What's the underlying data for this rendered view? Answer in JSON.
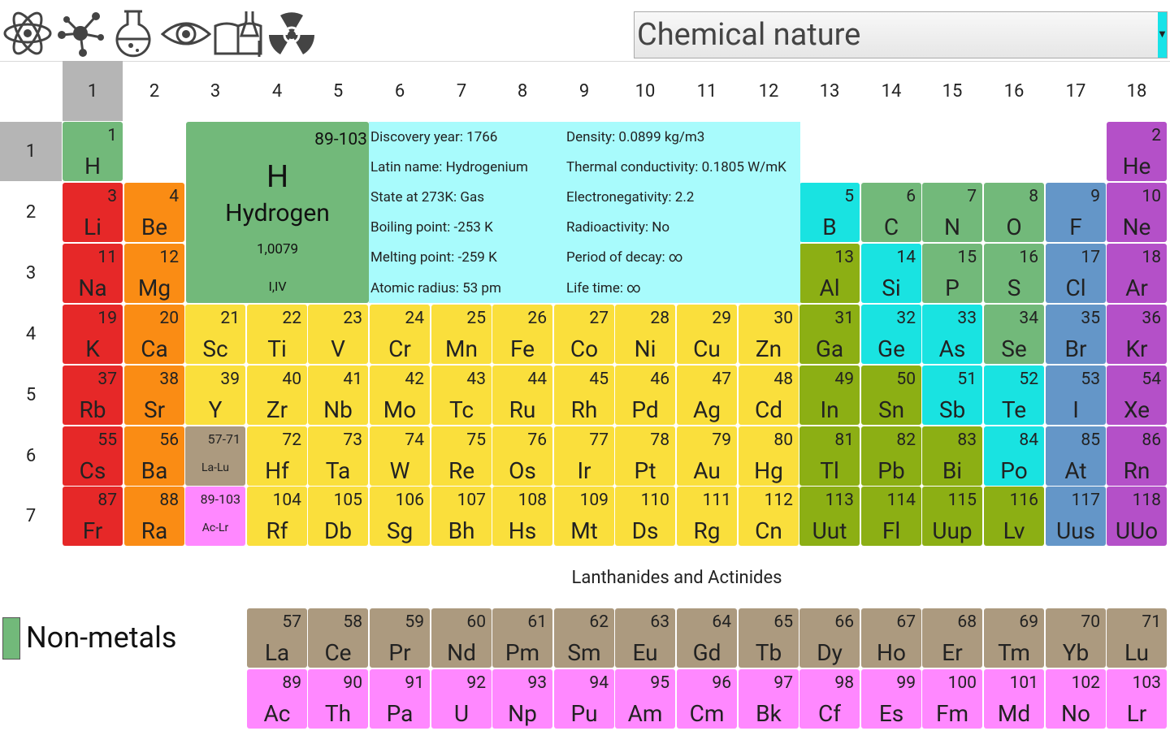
{
  "toolbar": {
    "icons": [
      "atom-icon",
      "molecule-icon",
      "flask-icon",
      "eye-icon",
      "book-lab-icon",
      "radiation-icon"
    ],
    "nature_select": {
      "value": "Chemical nature"
    }
  },
  "colors": {
    "alkali": "#e62828",
    "alkaline": "#fa8c14",
    "transition": "#fadf3c",
    "post_transition": "#8caf14",
    "metalloid": "#19e3e1",
    "nonmetal": "#72b97a",
    "halogen": "#6496c8",
    "noble": "#b450c8",
    "lanthanide": "#ac9a7f",
    "actinide": "#ff88ff",
    "info_bg": "#a8fbfc",
    "header_selected": "#b5b5b5"
  },
  "groups": [
    "1",
    "2",
    "3",
    "4",
    "5",
    "6",
    "7",
    "8",
    "9",
    "10",
    "11",
    "12",
    "13",
    "14",
    "15",
    "16",
    "17",
    "18"
  ],
  "periods": [
    "1",
    "2",
    "3",
    "4",
    "5",
    "6",
    "7"
  ],
  "selected_group": "1",
  "selected_period": "1",
  "selected": {
    "range_label": "89-103",
    "symbol": "H",
    "name": "Hydrogen",
    "mass": "1,0079",
    "oxidation": "I,IV"
  },
  "info": {
    "discovery": "Discovery year: 1766",
    "latin": "Latin name: Hydrogenium",
    "state": "State at 273K: Gas",
    "boiling": "Boiling point: -253 K",
    "melting": "Melting point: -259 K",
    "radius": "Atomic radius: 53 pm",
    "density": "Density: 0.0899 kg/m3",
    "conductivity": "Thermal conductivity: 0.1805 W/mK",
    "electroneg": "Electronegativity: 2.2",
    "radioactivity": "Radioactivity: No",
    "decay": "Period of decay: ∞",
    "lifetime": "Life time: ∞"
  },
  "elements": [
    {
      "n": "1",
      "s": "H",
      "g": 1,
      "p": 1,
      "c": "nonmetal"
    },
    {
      "n": "2",
      "s": "He",
      "g": 18,
      "p": 1,
      "c": "noble"
    },
    {
      "n": "3",
      "s": "Li",
      "g": 1,
      "p": 2,
      "c": "alkali"
    },
    {
      "n": "4",
      "s": "Be",
      "g": 2,
      "p": 2,
      "c": "alkaline"
    },
    {
      "n": "5",
      "s": "B",
      "g": 13,
      "p": 2,
      "c": "metalloid"
    },
    {
      "n": "6",
      "s": "C",
      "g": 14,
      "p": 2,
      "c": "nonmetal"
    },
    {
      "n": "7",
      "s": "N",
      "g": 15,
      "p": 2,
      "c": "nonmetal"
    },
    {
      "n": "8",
      "s": "O",
      "g": 16,
      "p": 2,
      "c": "nonmetal"
    },
    {
      "n": "9",
      "s": "F",
      "g": 17,
      "p": 2,
      "c": "halogen"
    },
    {
      "n": "10",
      "s": "Ne",
      "g": 18,
      "p": 2,
      "c": "noble"
    },
    {
      "n": "11",
      "s": "Na",
      "g": 1,
      "p": 3,
      "c": "alkali"
    },
    {
      "n": "12",
      "s": "Mg",
      "g": 2,
      "p": 3,
      "c": "alkaline"
    },
    {
      "n": "13",
      "s": "Al",
      "g": 13,
      "p": 3,
      "c": "post_transition"
    },
    {
      "n": "14",
      "s": "Si",
      "g": 14,
      "p": 3,
      "c": "metalloid"
    },
    {
      "n": "15",
      "s": "P",
      "g": 15,
      "p": 3,
      "c": "nonmetal"
    },
    {
      "n": "16",
      "s": "S",
      "g": 16,
      "p": 3,
      "c": "nonmetal"
    },
    {
      "n": "17",
      "s": "Cl",
      "g": 17,
      "p": 3,
      "c": "halogen"
    },
    {
      "n": "18",
      "s": "Ar",
      "g": 18,
      "p": 3,
      "c": "noble"
    },
    {
      "n": "19",
      "s": "K",
      "g": 1,
      "p": 4,
      "c": "alkali"
    },
    {
      "n": "20",
      "s": "Ca",
      "g": 2,
      "p": 4,
      "c": "alkaline"
    },
    {
      "n": "21",
      "s": "Sc",
      "g": 3,
      "p": 4,
      "c": "transition"
    },
    {
      "n": "22",
      "s": "Ti",
      "g": 4,
      "p": 4,
      "c": "transition"
    },
    {
      "n": "23",
      "s": "V",
      "g": 5,
      "p": 4,
      "c": "transition"
    },
    {
      "n": "24",
      "s": "Cr",
      "g": 6,
      "p": 4,
      "c": "transition"
    },
    {
      "n": "25",
      "s": "Mn",
      "g": 7,
      "p": 4,
      "c": "transition"
    },
    {
      "n": "26",
      "s": "Fe",
      "g": 8,
      "p": 4,
      "c": "transition"
    },
    {
      "n": "27",
      "s": "Co",
      "g": 9,
      "p": 4,
      "c": "transition"
    },
    {
      "n": "28",
      "s": "Ni",
      "g": 10,
      "p": 4,
      "c": "transition"
    },
    {
      "n": "29",
      "s": "Cu",
      "g": 11,
      "p": 4,
      "c": "transition"
    },
    {
      "n": "30",
      "s": "Zn",
      "g": 12,
      "p": 4,
      "c": "transition"
    },
    {
      "n": "31",
      "s": "Ga",
      "g": 13,
      "p": 4,
      "c": "post_transition"
    },
    {
      "n": "32",
      "s": "Ge",
      "g": 14,
      "p": 4,
      "c": "metalloid"
    },
    {
      "n": "33",
      "s": "As",
      "g": 15,
      "p": 4,
      "c": "metalloid"
    },
    {
      "n": "34",
      "s": "Se",
      "g": 16,
      "p": 4,
      "c": "nonmetal"
    },
    {
      "n": "35",
      "s": "Br",
      "g": 17,
      "p": 4,
      "c": "halogen"
    },
    {
      "n": "36",
      "s": "Kr",
      "g": 18,
      "p": 4,
      "c": "noble"
    },
    {
      "n": "37",
      "s": "Rb",
      "g": 1,
      "p": 5,
      "c": "alkali"
    },
    {
      "n": "38",
      "s": "Sr",
      "g": 2,
      "p": 5,
      "c": "alkaline"
    },
    {
      "n": "39",
      "s": "Y",
      "g": 3,
      "p": 5,
      "c": "transition"
    },
    {
      "n": "40",
      "s": "Zr",
      "g": 4,
      "p": 5,
      "c": "transition"
    },
    {
      "n": "41",
      "s": "Nb",
      "g": 5,
      "p": 5,
      "c": "transition"
    },
    {
      "n": "42",
      "s": "Mo",
      "g": 6,
      "p": 5,
      "c": "transition"
    },
    {
      "n": "43",
      "s": "Tc",
      "g": 7,
      "p": 5,
      "c": "transition"
    },
    {
      "n": "44",
      "s": "Ru",
      "g": 8,
      "p": 5,
      "c": "transition"
    },
    {
      "n": "45",
      "s": "Rh",
      "g": 9,
      "p": 5,
      "c": "transition"
    },
    {
      "n": "46",
      "s": "Pd",
      "g": 10,
      "p": 5,
      "c": "transition"
    },
    {
      "n": "47",
      "s": "Ag",
      "g": 11,
      "p": 5,
      "c": "transition"
    },
    {
      "n": "48",
      "s": "Cd",
      "g": 12,
      "p": 5,
      "c": "transition"
    },
    {
      "n": "49",
      "s": "In",
      "g": 13,
      "p": 5,
      "c": "post_transition"
    },
    {
      "n": "50",
      "s": "Sn",
      "g": 14,
      "p": 5,
      "c": "post_transition"
    },
    {
      "n": "51",
      "s": "Sb",
      "g": 15,
      "p": 5,
      "c": "metalloid"
    },
    {
      "n": "52",
      "s": "Te",
      "g": 16,
      "p": 5,
      "c": "metalloid"
    },
    {
      "n": "53",
      "s": "I",
      "g": 17,
      "p": 5,
      "c": "halogen"
    },
    {
      "n": "54",
      "s": "Xe",
      "g": 18,
      "p": 5,
      "c": "noble"
    },
    {
      "n": "55",
      "s": "Cs",
      "g": 1,
      "p": 6,
      "c": "alkali"
    },
    {
      "n": "56",
      "s": "Ba",
      "g": 2,
      "p": 6,
      "c": "alkaline"
    },
    {
      "n": "57-71",
      "s": "La-Lu",
      "g": 3,
      "p": 6,
      "c": "lanthanide",
      "range": true
    },
    {
      "n": "72",
      "s": "Hf",
      "g": 4,
      "p": 6,
      "c": "transition"
    },
    {
      "n": "73",
      "s": "Ta",
      "g": 5,
      "p": 6,
      "c": "transition"
    },
    {
      "n": "74",
      "s": "W",
      "g": 6,
      "p": 6,
      "c": "transition"
    },
    {
      "n": "75",
      "s": "Re",
      "g": 7,
      "p": 6,
      "c": "transition"
    },
    {
      "n": "76",
      "s": "Os",
      "g": 8,
      "p": 6,
      "c": "transition"
    },
    {
      "n": "77",
      "s": "Ir",
      "g": 9,
      "p": 6,
      "c": "transition"
    },
    {
      "n": "78",
      "s": "Pt",
      "g": 10,
      "p": 6,
      "c": "transition"
    },
    {
      "n": "79",
      "s": "Au",
      "g": 11,
      "p": 6,
      "c": "transition"
    },
    {
      "n": "80",
      "s": "Hg",
      "g": 12,
      "p": 6,
      "c": "transition"
    },
    {
      "n": "81",
      "s": "Tl",
      "g": 13,
      "p": 6,
      "c": "post_transition"
    },
    {
      "n": "82",
      "s": "Pb",
      "g": 14,
      "p": 6,
      "c": "post_transition"
    },
    {
      "n": "83",
      "s": "Bi",
      "g": 15,
      "p": 6,
      "c": "post_transition"
    },
    {
      "n": "84",
      "s": "Po",
      "g": 16,
      "p": 6,
      "c": "metalloid"
    },
    {
      "n": "85",
      "s": "At",
      "g": 17,
      "p": 6,
      "c": "halogen"
    },
    {
      "n": "86",
      "s": "Rn",
      "g": 18,
      "p": 6,
      "c": "noble"
    },
    {
      "n": "87",
      "s": "Fr",
      "g": 1,
      "p": 7,
      "c": "alkali"
    },
    {
      "n": "88",
      "s": "Ra",
      "g": 2,
      "p": 7,
      "c": "alkaline"
    },
    {
      "n": "89-103",
      "s": "Ac-Lr",
      "g": 3,
      "p": 7,
      "c": "actinide",
      "range": true
    },
    {
      "n": "104",
      "s": "Rf",
      "g": 4,
      "p": 7,
      "c": "transition"
    },
    {
      "n": "105",
      "s": "Db",
      "g": 5,
      "p": 7,
      "c": "transition"
    },
    {
      "n": "106",
      "s": "Sg",
      "g": 6,
      "p": 7,
      "c": "transition"
    },
    {
      "n": "107",
      "s": "Bh",
      "g": 7,
      "p": 7,
      "c": "transition"
    },
    {
      "n": "108",
      "s": "Hs",
      "g": 8,
      "p": 7,
      "c": "transition"
    },
    {
      "n": "109",
      "s": "Mt",
      "g": 9,
      "p": 7,
      "c": "transition"
    },
    {
      "n": "110",
      "s": "Ds",
      "g": 10,
      "p": 7,
      "c": "transition"
    },
    {
      "n": "111",
      "s": "Rg",
      "g": 11,
      "p": 7,
      "c": "transition"
    },
    {
      "n": "112",
      "s": "Cn",
      "g": 12,
      "p": 7,
      "c": "transition"
    },
    {
      "n": "113",
      "s": "Uut",
      "g": 13,
      "p": 7,
      "c": "post_transition"
    },
    {
      "n": "114",
      "s": "Fl",
      "g": 14,
      "p": 7,
      "c": "post_transition"
    },
    {
      "n": "115",
      "s": "Uup",
      "g": 15,
      "p": 7,
      "c": "post_transition"
    },
    {
      "n": "116",
      "s": "Lv",
      "g": 16,
      "p": 7,
      "c": "post_transition"
    },
    {
      "n": "117",
      "s": "Uus",
      "g": 17,
      "p": 7,
      "c": "halogen"
    },
    {
      "n": "118",
      "s": "UUo",
      "g": 18,
      "p": 7,
      "c": "noble"
    }
  ],
  "lanthanides_title": "Lanthanides and Actinides",
  "lanthanides": [
    {
      "n": "57",
      "s": "La"
    },
    {
      "n": "58",
      "s": "Ce"
    },
    {
      "n": "59",
      "s": "Pr"
    },
    {
      "n": "60",
      "s": "Nd"
    },
    {
      "n": "61",
      "s": "Pm"
    },
    {
      "n": "62",
      "s": "Sm"
    },
    {
      "n": "63",
      "s": "Eu"
    },
    {
      "n": "64",
      "s": "Gd"
    },
    {
      "n": "65",
      "s": "Tb"
    },
    {
      "n": "66",
      "s": "Dy"
    },
    {
      "n": "67",
      "s": "Ho"
    },
    {
      "n": "68",
      "s": "Er"
    },
    {
      "n": "69",
      "s": "Tm"
    },
    {
      "n": "70",
      "s": "Yb"
    },
    {
      "n": "71",
      "s": "Lu"
    }
  ],
  "actinides": [
    {
      "n": "89",
      "s": "Ac"
    },
    {
      "n": "90",
      "s": "Th"
    },
    {
      "n": "91",
      "s": "Pa"
    },
    {
      "n": "92",
      "s": "U"
    },
    {
      "n": "93",
      "s": "Np"
    },
    {
      "n": "94",
      "s": "Pu"
    },
    {
      "n": "95",
      "s": "Am"
    },
    {
      "n": "96",
      "s": "Cm"
    },
    {
      "n": "97",
      "s": "Bk"
    },
    {
      "n": "98",
      "s": "Cf"
    },
    {
      "n": "99",
      "s": "Es"
    },
    {
      "n": "100",
      "s": "Fm"
    },
    {
      "n": "101",
      "s": "Md"
    },
    {
      "n": "102",
      "s": "No"
    },
    {
      "n": "103",
      "s": "Lr"
    }
  ],
  "legend": {
    "label": "Non-metals"
  }
}
